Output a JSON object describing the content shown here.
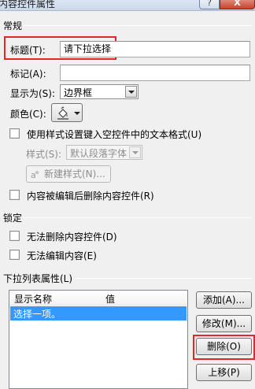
{
  "window": {
    "title": "内容控件属性",
    "help_label": "?",
    "close_label": "X"
  },
  "general": {
    "section_label": "常规",
    "title_label": "标题(T):",
    "title_value": "请下拉选择",
    "tag_label": "标记(A):",
    "tag_value": "",
    "show_as_label": "显示为(S):",
    "show_as_value": "边界框",
    "color_label": "颜色(C):",
    "use_style_label": "使用样式设置键入空控件中的文本格式(U)",
    "style_label": "样式(S):",
    "style_value": "默认段落字体",
    "new_style_label": "新建样式(N)...",
    "remove_on_edit_label": "内容被编辑后删除内容控件(R)"
  },
  "locking": {
    "section_label": "锁定",
    "cannot_delete_label": "无法删除内容控件(D)",
    "cannot_edit_label": "无法编辑内容(E)"
  },
  "dropdown": {
    "section_label": "下拉列表属性(L)",
    "columns": [
      "显示名称",
      "值"
    ],
    "items": [
      {
        "display": "选择一项。",
        "value": ""
      }
    ],
    "buttons": {
      "add": "添加(A)...",
      "modify": "修改(M)...",
      "delete": "删除(O)",
      "move_up": "上移(P)"
    }
  },
  "colors": {
    "highlight": "#e32626",
    "selection": "#3399ff"
  }
}
